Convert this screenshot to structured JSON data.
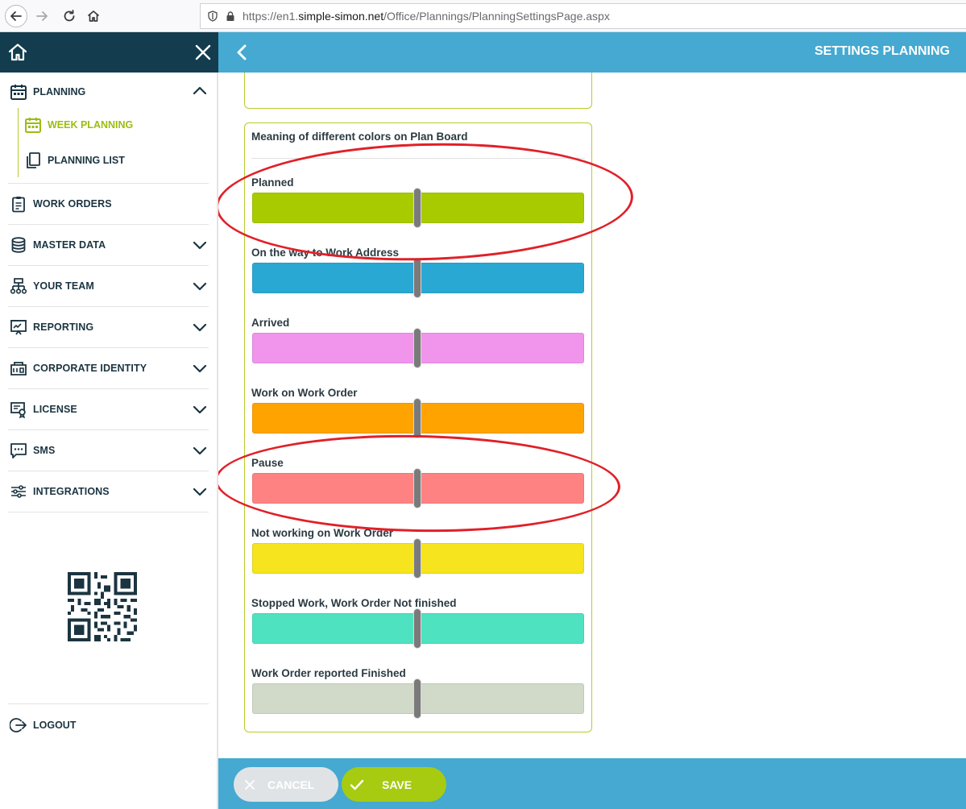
{
  "browser": {
    "url_prefix": "https://en1.",
    "url_domain": "simple-simon.net",
    "url_path": "/Office/Plannings/PlanningSettingsPage.aspx",
    "icons": [
      "back-arrow-icon",
      "forward-arrow-icon",
      "reload-icon",
      "home-icon",
      "shield-icon",
      "lock-icon"
    ]
  },
  "sidebar": {
    "header_icons": [
      "home-icon",
      "close-icon"
    ],
    "planning": {
      "label": "PLANNING",
      "expanded": true,
      "sub_items": [
        {
          "label": "WEEK PLANNING",
          "active": true,
          "icon": "calendar-icon"
        },
        {
          "label": "PLANNING LIST",
          "active": false,
          "icon": "copy-list-icon"
        }
      ]
    },
    "items": [
      {
        "label": "WORK ORDERS",
        "icon": "clipboard-icon",
        "has_chevron": false
      },
      {
        "label": "MASTER DATA",
        "icon": "database-icon",
        "has_chevron": true
      },
      {
        "label": "YOUR TEAM",
        "icon": "org-chart-icon",
        "has_chevron": true
      },
      {
        "label": "REPORTING",
        "icon": "presentation-icon",
        "has_chevron": true
      },
      {
        "label": "CORPORATE IDENTITY",
        "icon": "id-card-icon",
        "has_chevron": true
      },
      {
        "label": "LICENSE",
        "icon": "certificate-icon",
        "has_chevron": true
      },
      {
        "label": "SMS",
        "icon": "chat-icon",
        "has_chevron": true
      },
      {
        "label": "INTEGRATIONS",
        "icon": "sliders-icon",
        "has_chevron": true
      }
    ],
    "logout_label": "LOGOUT"
  },
  "header": {
    "title": "SETTINGS PLANNING"
  },
  "colors_card": {
    "title": "Meaning of different colors on Plan Board",
    "rows": [
      {
        "label": "Planned",
        "color": "#a8cb00"
      },
      {
        "label": "On the way to Work Address",
        "color": "#2aa8d4"
      },
      {
        "label": "Arrived",
        "color": "#f094ec"
      },
      {
        "label": "Work on Work Order",
        "color": "#ffa300"
      },
      {
        "label": "Pause",
        "color": "#ff8283"
      },
      {
        "label": "Not working on Work Order",
        "color": "#f5e41e"
      },
      {
        "label": "Stopped Work, Work Order Not finished",
        "color": "#4fe2c0"
      },
      {
        "label": "Work Order reported Finished",
        "color": "#d1d9c9"
      }
    ]
  },
  "footer": {
    "cancel_label": "CANCEL",
    "save_label": "SAVE"
  },
  "theme": {
    "sidebar_header": "#133c4e",
    "topbar": "#45a9d1",
    "accent": "#a7cb10",
    "annotation": "#e12028"
  }
}
